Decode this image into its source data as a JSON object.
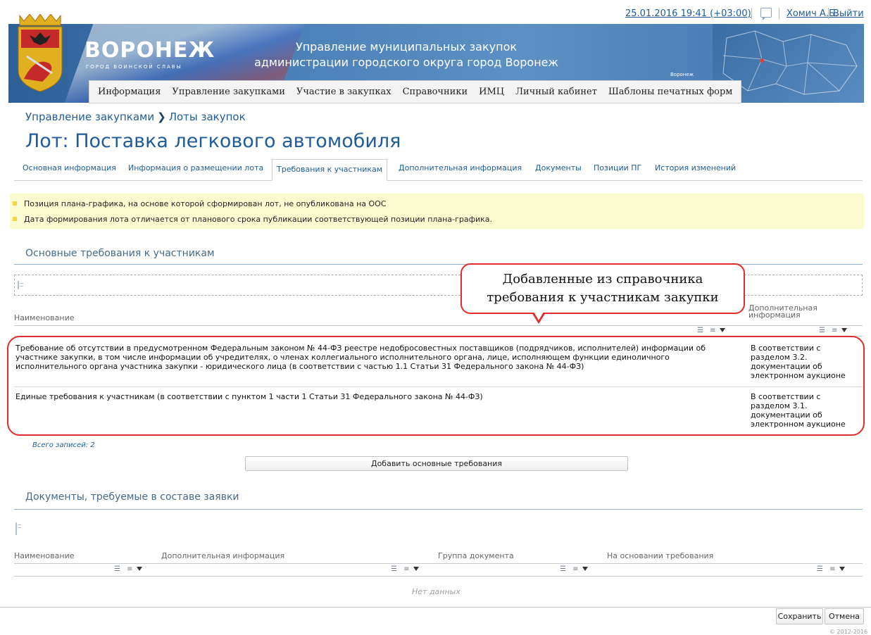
{
  "topbar": {
    "datetime": "25.01.2016 19:41 (+03:00)",
    "user": "Хомич А.Б.",
    "logout": "Выйти"
  },
  "banner": {
    "city": "ВОРОНЕЖ",
    "city_subtitle": "ГОРОД ВОИНСКОЙ СЛАВЫ",
    "title_line1": "Управление муниципальных закупок",
    "title_line2": "администрации городского округа город Воронеж",
    "map_caption": "Воронеж"
  },
  "menu": [
    "Информация",
    "Управление закупками",
    "Участие в закупках",
    "Справочники",
    "ИМЦ",
    "Личный кабинет",
    "Шаблоны печатных форм"
  ],
  "breadcrumb": {
    "parent": "Управление закупками",
    "current": "Лоты закупок"
  },
  "page_title": "Лот: Поставка легкового автомобиля",
  "tabs": [
    "Основная информация",
    "Информация о размещении лота",
    "Требования к участникам",
    "Дополнительная информация",
    "Документы",
    "Позиции ПГ",
    "История изменений"
  ],
  "warnings": [
    "Позиция плана-графика, на основе которой сформирован лот, не опубликована на ООС",
    "Дата формирования лота отличается от планового срока публикации соответствующей позиции плана-графика."
  ],
  "requirements": {
    "section_title": "Основные требования к участникам",
    "columns": {
      "name": "Наименование",
      "extra_line1": "Дополнительная",
      "extra_line2": "информация"
    },
    "rows": [
      {
        "name_lines": [
          "Требование об отсутствии в предусмотренном Федеральным законом № 44-ФЗ реестре недобросовестных поставщиков (подрядчиков, исполнителей) информации об",
          "участнике закупки, в том числе информации об учредителях, о членах коллегиального исполнительного органа, лице, исполняющем функции единоличного",
          "исполнительного органа участника закупки - юридического лица (в соответствии с частью 1.1 Статьи 31 Федерального закона № 44-ФЗ)"
        ],
        "extra_lines": [
          "В соответствии с",
          "разделом 3.2.",
          "документации об",
          "электронном аукционе"
        ]
      },
      {
        "name_lines": [
          "Единые требования к участникам (в соответствии с пунктом 1 части 1 Статьи 31 Федерального закона № 44-ФЗ)"
        ],
        "extra_lines": [
          "В соответствии с",
          "разделом 3.1.",
          "документации об",
          "электронном аукционе"
        ]
      }
    ],
    "total": "Всего записей: 2",
    "add_button": "Добавить основные требования"
  },
  "callout": {
    "line1": "Добавленные из справочника",
    "line2": "требования к участникам закупки"
  },
  "documents": {
    "section_title": "Документы, требуемые в составе заявки",
    "columns": [
      "Наименование",
      "Дополнительная информация",
      "Группа документа",
      "На основании требования"
    ],
    "empty": "Нет данных"
  },
  "footer": {
    "save": "Сохранить",
    "cancel": "Отмена",
    "copyright": "© 2012-2016"
  },
  "colors": {
    "link": "#1f5c99",
    "highlight": "#e32b2b",
    "warning_bg": "#fdfbd0"
  }
}
